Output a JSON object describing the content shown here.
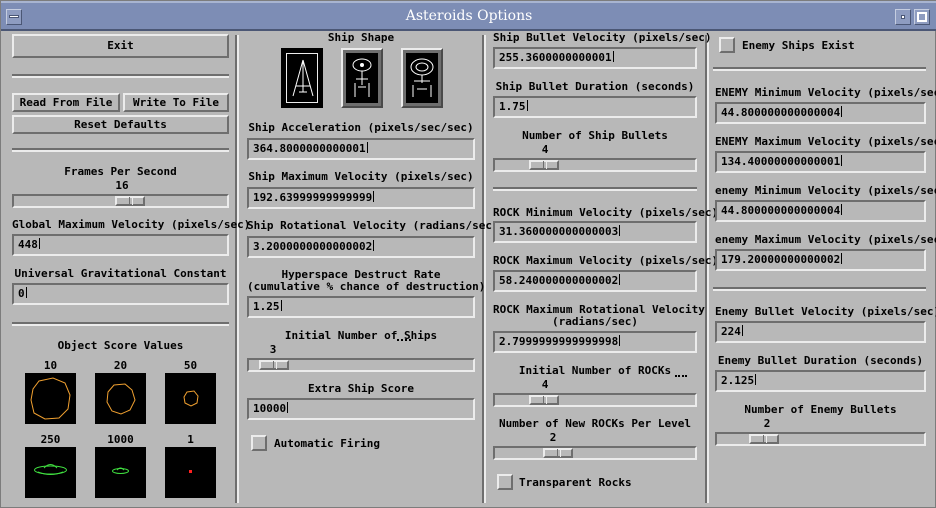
{
  "window": {
    "title": "Asteroids Options"
  },
  "col1": {
    "exit_label": "Exit",
    "read_label": "Read From File",
    "write_label": "Write To File",
    "reset_label": "Reset Defaults",
    "fps_label": "Frames Per Second",
    "fps_value": "16",
    "fps_fraction": 0.55,
    "gmv_label": "Global Maximum Velocity (pixels/sec)",
    "gmv_value": "448",
    "ugc_label": "Universal Gravitational Constant",
    "ugc_value": "0",
    "scores_label": "Object Score Values",
    "scores": [
      "10",
      "20",
      "50",
      "250",
      "1000",
      "1"
    ]
  },
  "col2": {
    "shape_label": "Ship Shape",
    "accel_label": "Ship Acceleration (pixels/sec/sec)",
    "accel_value": "364.8000000000001",
    "maxvel_label": "Ship Maximum Velocity (pixels/sec)",
    "maxvel_value": "192.63999999999999",
    "rot_label": "Ship Rotational Velocity (radians/sec)",
    "rot_value": "3.2000000000000002",
    "hyper_label1": "Hyperspace Destruct Rate",
    "hyper_label2": "(cumulative % chance of destruction)",
    "hyper_value": "1.25",
    "ships_label": "Initial Number of Ships",
    "ships_value": "3",
    "ships_fraction": 0.05,
    "extra_label": "Extra Ship Score",
    "extra_value": "10000",
    "autofire_label": "Automatic Firing"
  },
  "col3": {
    "bvel_label": "Ship Bullet Velocity (pixels/sec)",
    "bvel_value": "255.3600000000001",
    "bdur_label": "Ship Bullet Duration (seconds)",
    "bdur_value": "1.75",
    "nbul_label": "Number of Ship Bullets",
    "nbul_value": "4",
    "nbul_fraction": 0.2,
    "rminv_label": "ROCK Minimum Velocity (pixels/sec)",
    "rminv_value": "31.360000000000003",
    "rmaxv_label": "ROCK Maximum Velocity (pixels/sec)",
    "rmaxv_value": "58.240000000000002",
    "rrot_label1": "ROCK Maximum Rotational Velocity",
    "rrot_label2": "(radians/sec)",
    "rrot_value": "2.7999999999999998",
    "nrock_label": "Initial Number of ROCKs",
    "nrock_value": "4",
    "nrock_fraction": 0.2,
    "newrock_label": "Number of New ROCKs Per Level",
    "newrock_value": "2",
    "newrock_fraction": 0.28,
    "transparent_label": "Transparent Rocks"
  },
  "col4": {
    "enemy_exist_label": "Enemy Ships Exist",
    "eminv_label": "ENEMY Minimum Velocity (pixels/sec)",
    "eminv_value": "44.800000000000004",
    "emaxv_label": "ENEMY Maximum Velocity (pixels/sec)",
    "emaxv_value": "134.40000000000001",
    "e2minv_label": "enemy Minimum Velocity (pixels/sec)",
    "e2minv_value": "44.800000000000004",
    "e2maxv_label": "enemy Maximum Velocity (pixels/sec)",
    "e2maxv_value": "179.20000000000002",
    "ebvel_label": "Enemy Bullet Velocity (pixels/sec)",
    "ebvel_value": "224",
    "ebdur_label": "Enemy Bullet Duration (seconds)",
    "ebdur_value": "2.125",
    "enbul_label": "Number of Enemy Bullets",
    "enbul_value": "2",
    "enbul_fraction": 0.18
  },
  "colors": {
    "window_bg": "#b8b8b8",
    "titlebar": "#7d8db5",
    "rock": "#f0a030",
    "saucer": "#40e040",
    "dot": "#ff2020"
  }
}
